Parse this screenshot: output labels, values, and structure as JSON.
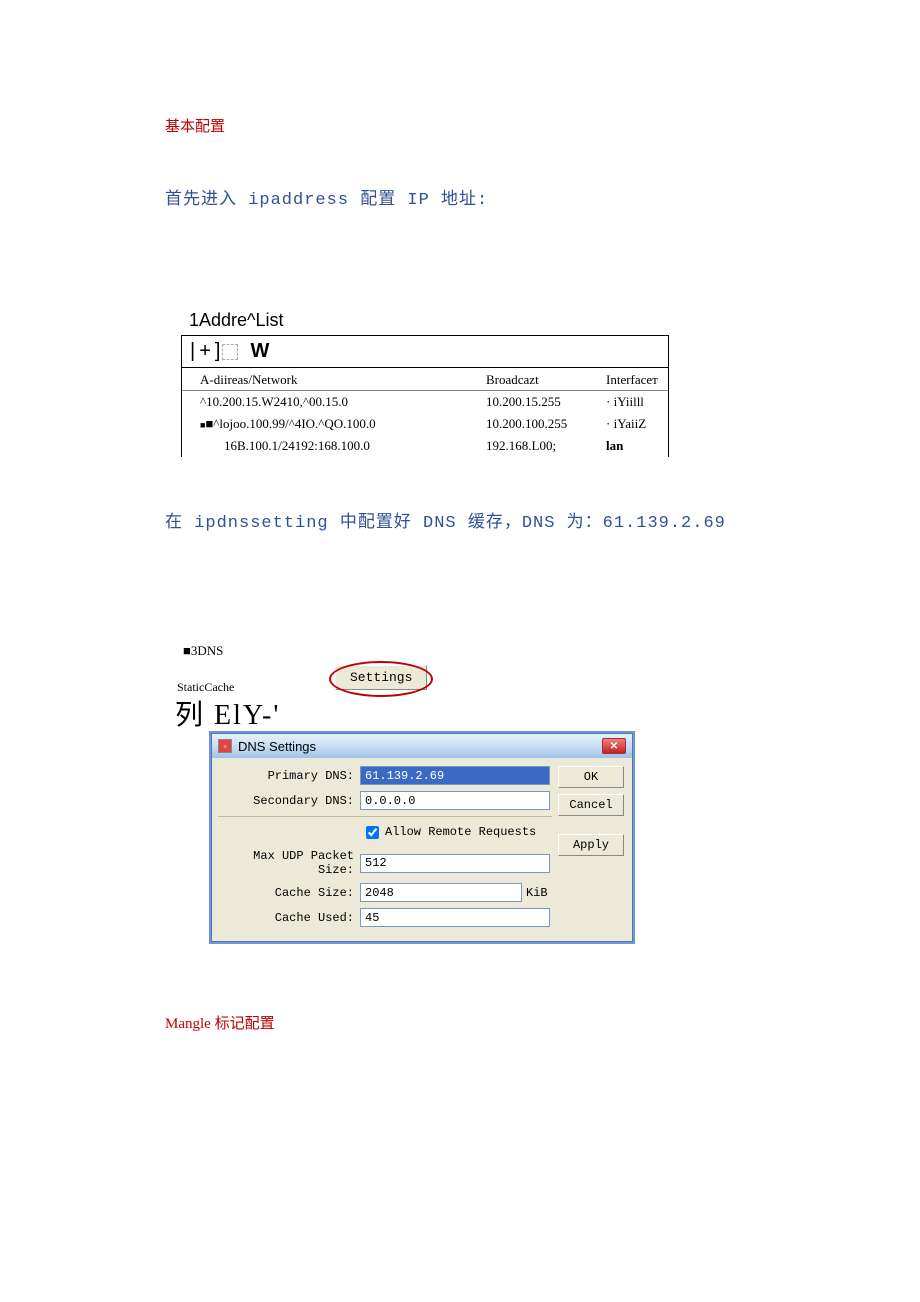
{
  "headings": {
    "basic_config": "基本配置",
    "ip_intro": "首先进入 ipaddress 配置 IP 地址:",
    "dns_intro": "在 ipdnssetting 中配置好 DNS 缓存，DNS 为：61.139.2.69",
    "mangle": "Mangle 标记配置"
  },
  "addr_list": {
    "title": "1Addre^List",
    "toolbar_w": "W",
    "columns": {
      "c1": "A-diireas/Network",
      "c2": "Broadcazt",
      "c3": "Interfaceᴛ"
    },
    "rows": [
      {
        "a": "^10.200.15.W2410,^00.15.0",
        "b": "10.200.15.255",
        "i": "· iYiilll"
      },
      {
        "a": "■^lojoo.100.99/^4IO.^QO.100.0",
        "b": "10.200.100.255",
        "i": "· iYaiiZ"
      },
      {
        "a": "16B.100.1/24192:168.100.0",
        "b": "192.168.L00;",
        "i": "lan"
      }
    ]
  },
  "dns_section": {
    "label1": "■3DNS",
    "settings_btn": "Settings",
    "static_cache": "StaticCache",
    "lie": "列 ElY-'"
  },
  "dns_window": {
    "title": "DNS Settings",
    "close": "✕",
    "primary_label": "Primary DNS:",
    "primary_value": "61.139.2.69",
    "secondary_label": "Secondary DNS:",
    "secondary_value": "0.0.0.0",
    "allow_remote": "Allow Remote Requests",
    "max_udp_label": "Max UDP Packet Size:",
    "max_udp_value": "512",
    "cache_size_label": "Cache Size:",
    "cache_size_value": "2048",
    "cache_size_unit": "KiB",
    "cache_used_label": "Cache Used:",
    "cache_used_value": "45",
    "ok": "OK",
    "cancel": "Cancel",
    "apply": "Apply"
  }
}
